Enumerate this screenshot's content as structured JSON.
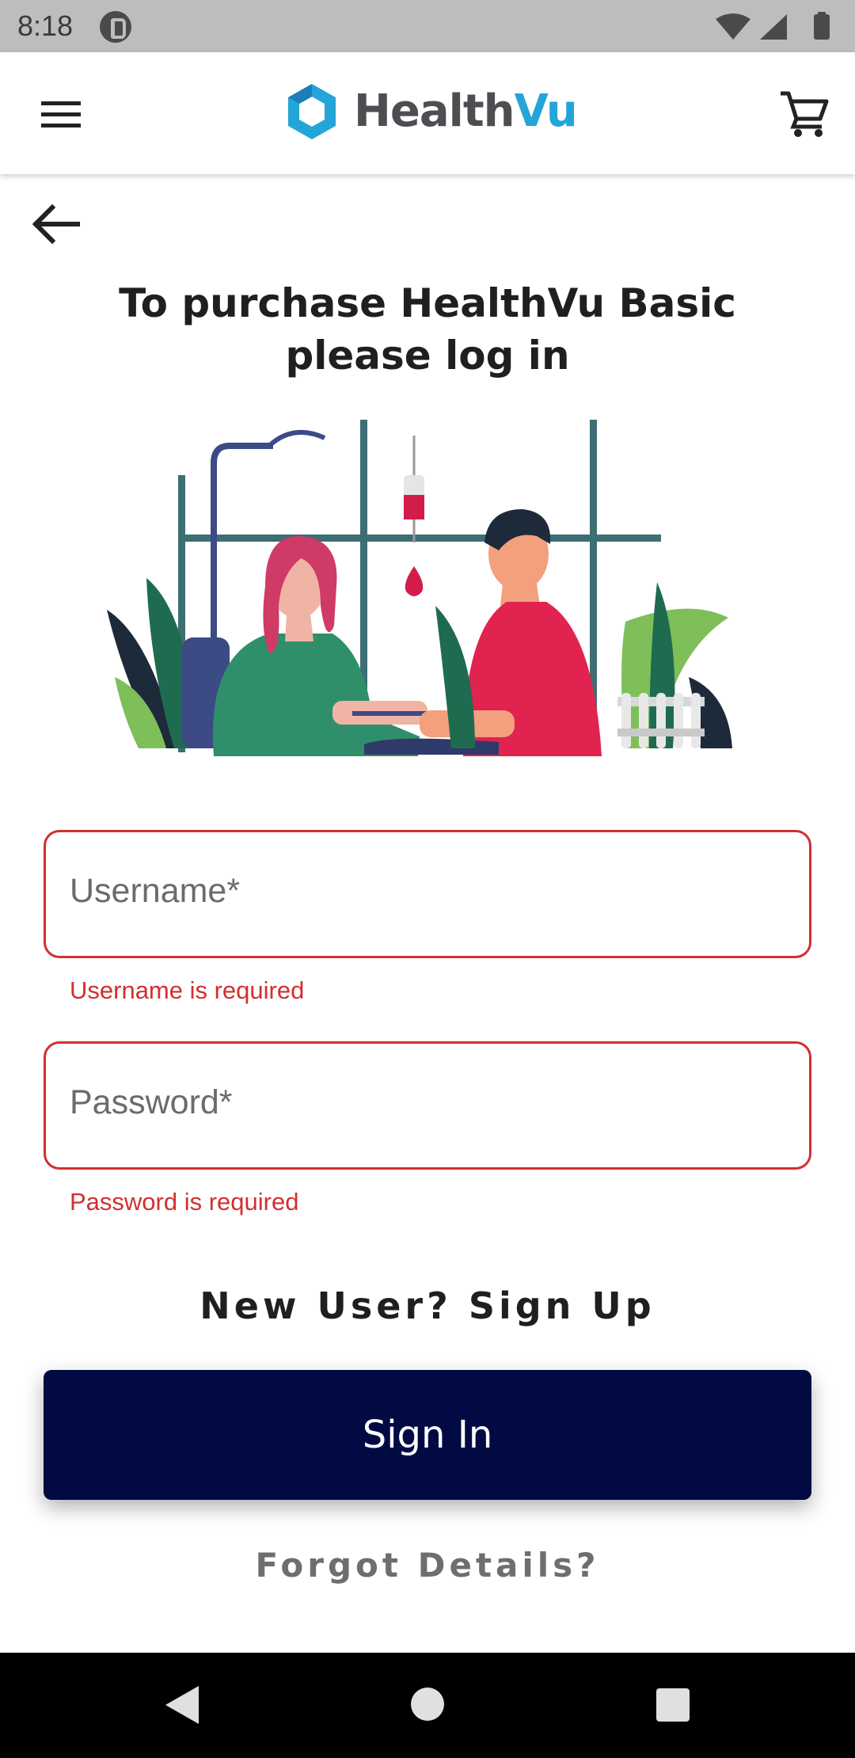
{
  "status_bar": {
    "time": "8:18",
    "icons": [
      "app-notification-icon",
      "wifi-icon",
      "cellular-signal-icon",
      "battery-icon"
    ]
  },
  "app_bar": {
    "brand_part1": "Health",
    "brand_part2": "Vu",
    "icons": [
      "hamburger-menu-icon",
      "brand-logo-icon",
      "shopping-cart-icon"
    ],
    "colors": {
      "brand_gray": "#4d4d52",
      "brand_blue": "#23a5d8"
    }
  },
  "page": {
    "back_icon": "arrow-left-icon",
    "title_line1": "To purchase HealthVu Basic",
    "title_line2": "please log in",
    "illustration": "blood-draw-illustration"
  },
  "form": {
    "username": {
      "label": "Username*",
      "value": "",
      "error": "Username is required"
    },
    "password": {
      "label": "Password*",
      "value": "",
      "error": "Password is required"
    },
    "signup_label": "New User? Sign Up",
    "signin_label": "Sign In",
    "forgot_label": "Forgot Details?",
    "colors": {
      "error": "#d32f2f",
      "primary_button": "#020a43"
    }
  },
  "nav_bar": {
    "icons": [
      "nav-back-icon",
      "nav-home-icon",
      "nav-recents-icon"
    ]
  }
}
